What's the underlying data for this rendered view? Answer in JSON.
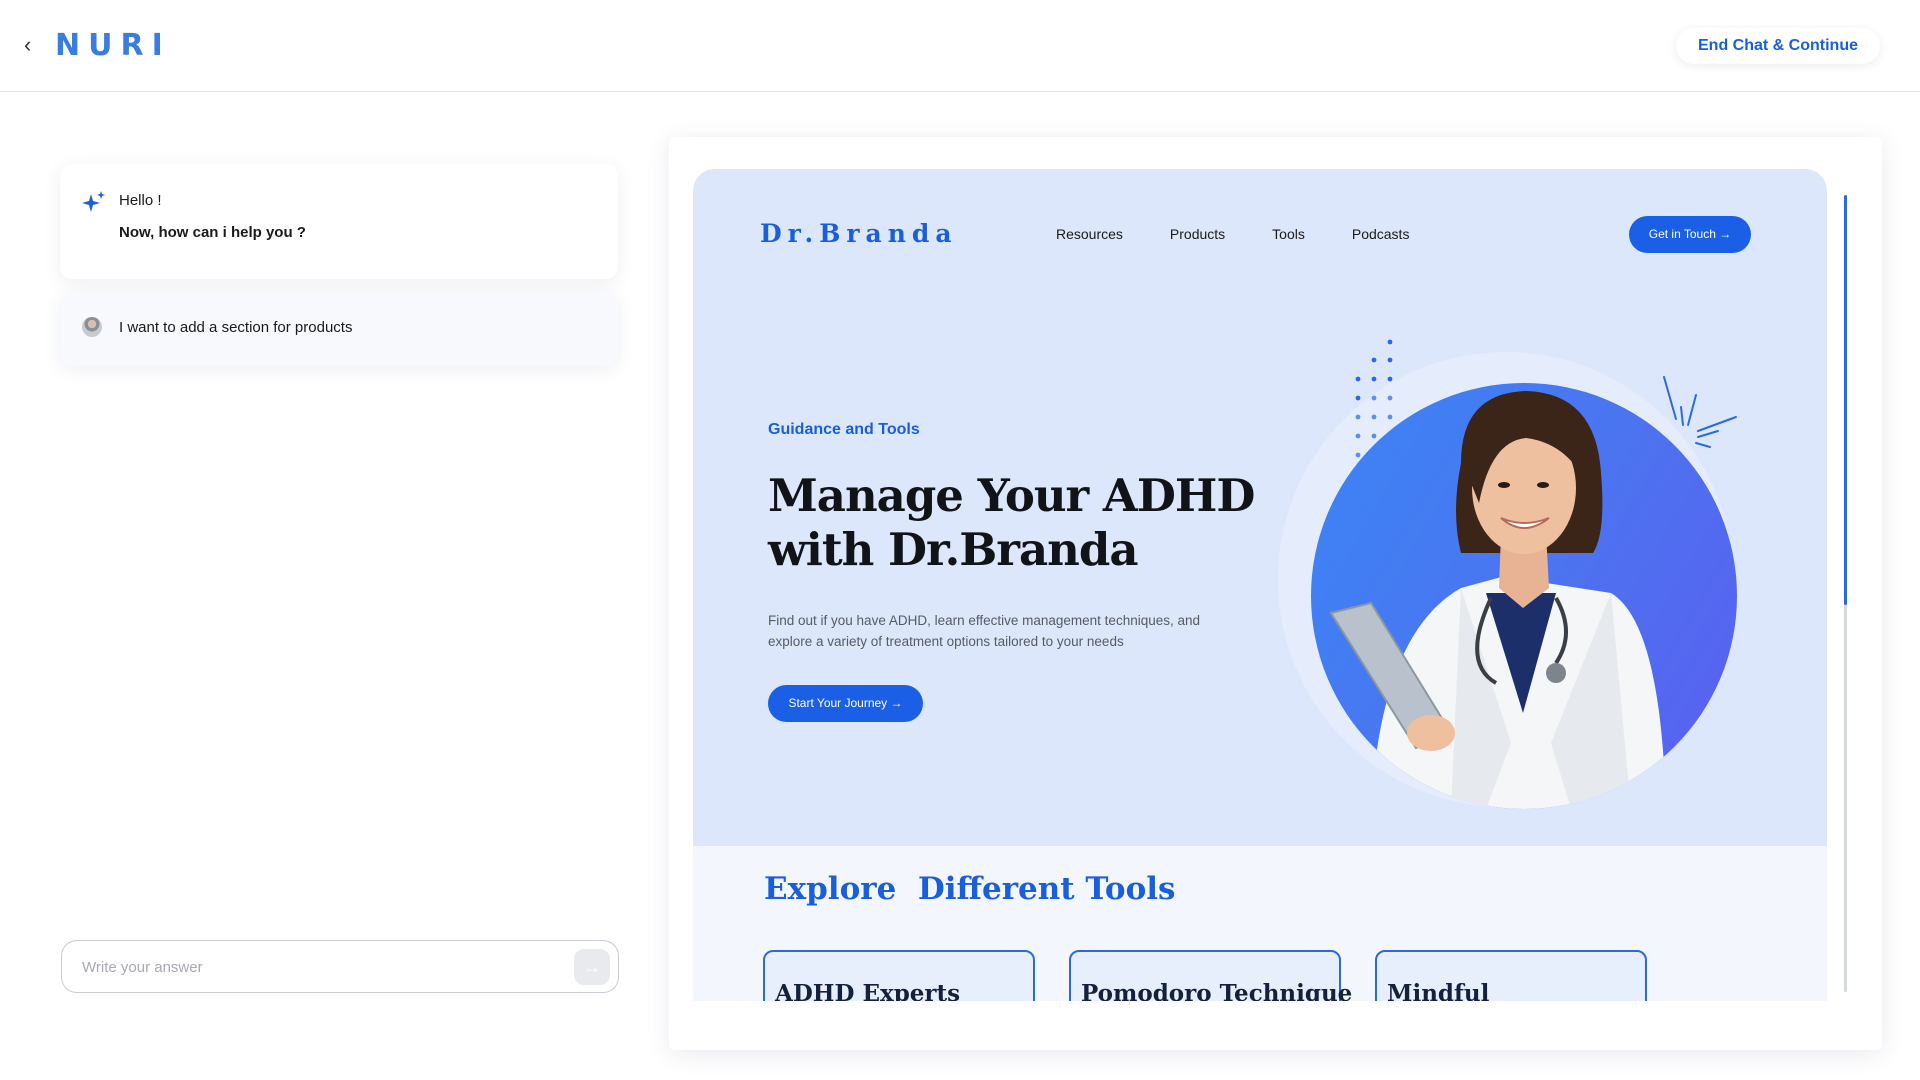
{
  "header": {
    "back_icon": "chevron-left-icon",
    "logo_text": "NURI",
    "end_chat_label": "End Chat & Continue"
  },
  "chat": {
    "bot_message": {
      "icon": "sparkle-icon",
      "greeting": "Hello !",
      "question": "Now, how can i help you ?"
    },
    "user_message": {
      "avatar": "user-avatar",
      "text": "I want to add a section for products"
    },
    "input": {
      "placeholder": "Write your answer",
      "value": "",
      "send_icon": "arrow-right-icon"
    }
  },
  "preview": {
    "brand": "Dr.Branda",
    "nav": [
      "Resources",
      "Products",
      "Tools",
      "Podcasts"
    ],
    "cta_label": "Get in Touch →",
    "hero": {
      "eyebrow": "Guidance and Tools",
      "headline": "Manage Your ADHD with Dr.Branda",
      "subtext": "Find out if you have ADHD, learn effective management techniques, and explore a variety of treatment options tailored to your needs",
      "button_label": "Start Your Journey →",
      "image": "doctor-portrait"
    },
    "tools": {
      "title": "Explore  Different Tools",
      "cards": [
        "ADHD Experts",
        "Pomodoro Technique",
        "Mindful"
      ]
    }
  },
  "colors": {
    "accent": "#1a5fd9",
    "hero_bg": "#dde7fb",
    "button_bg": "#1a5fe6"
  }
}
